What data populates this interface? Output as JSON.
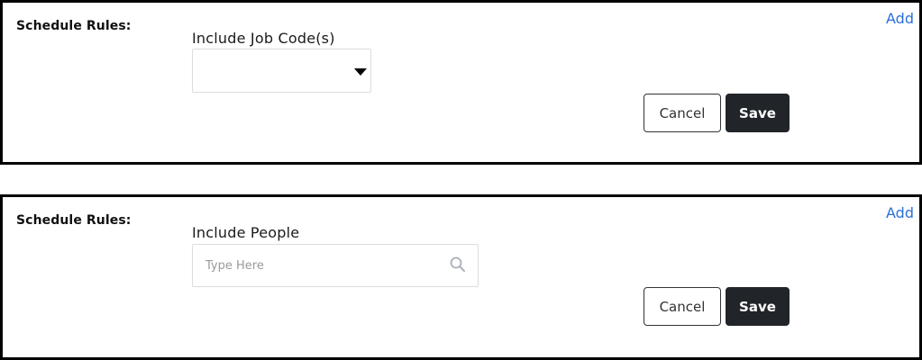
{
  "colors": {
    "link": "#2a6fdb",
    "save_button_bg": "#212529",
    "border": "#000000"
  },
  "panels": [
    {
      "section_label": "Schedule Rules:",
      "add_link": "Add",
      "field_label": "Include Job Code(s)",
      "field_type": "select",
      "selected_value": "",
      "cancel_label": "Cancel",
      "save_label": "Save"
    },
    {
      "section_label": "Schedule Rules:",
      "add_link": "Add",
      "field_label": "Include People",
      "field_type": "search",
      "search_placeholder": "Type Here",
      "search_icon": "magnifier-icon",
      "cancel_label": "Cancel",
      "save_label": "Save"
    }
  ]
}
